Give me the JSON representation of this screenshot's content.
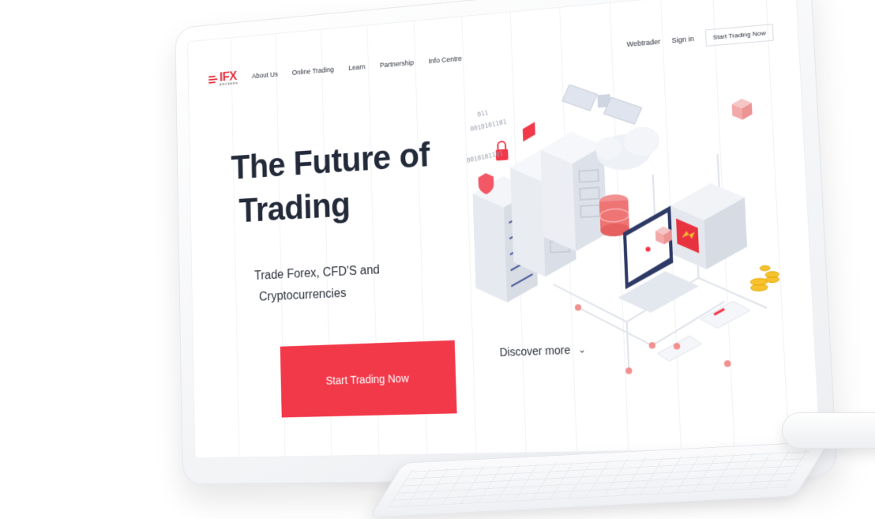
{
  "nav": {
    "logo_text": "IFX",
    "logo_sub": "BROKERS",
    "links": [
      "About Us",
      "Online Trading",
      "Learn",
      "Partnership",
      "Info Centre"
    ],
    "webtrader": "Webtrader",
    "signin": "Sign in",
    "cta": "Start Trading Now"
  },
  "hero": {
    "title_line1": "The Future of",
    "title_line2": "Trading",
    "subtitle_line1": "Trade Forex, CFD'S and",
    "subtitle_line2": "Cryptocurrencies",
    "button": "Start Trading Now",
    "discover": "Discover more"
  },
  "illustration": {
    "binary_1": "0010101101",
    "binary_2": "011"
  },
  "colors": {
    "accent": "#f2394a",
    "text_dark": "#232a3a"
  }
}
